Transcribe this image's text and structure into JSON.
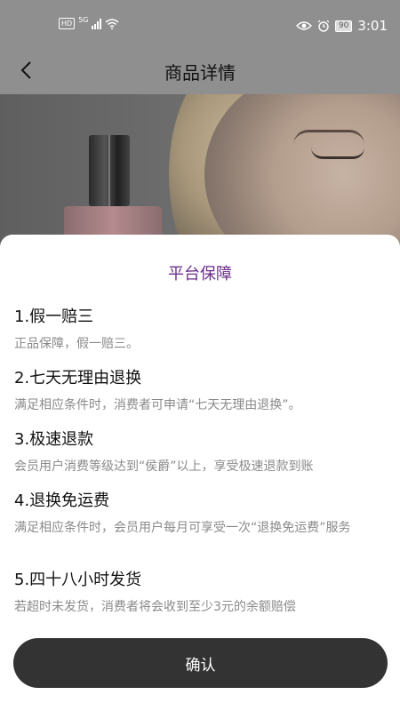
{
  "status_bar": {
    "hd": "HD",
    "network": "5G",
    "battery": "90",
    "time": "3:01"
  },
  "header": {
    "title": "商品详情"
  },
  "sheet": {
    "title": "平台保障",
    "items": [
      {
        "title": "1.假一赔三",
        "desc": "正品保障，假一赔三。"
      },
      {
        "title": "2.七天无理由退换",
        "desc": "满足相应条件时，消费者可申请“七天无理由退换”。"
      },
      {
        "title": "3.极速退款",
        "desc": "会员用户消费等级达到“侯爵”以上，享受极速退款到账"
      },
      {
        "title": "4.退换免运费",
        "desc": "满足相应条件时，会员用户每月可享受一次“退换免运费”服务"
      },
      {
        "title": "5.四十八小时发货",
        "desc": "若超时未发货，消费者将会收到至少3元的余额赔偿"
      }
    ],
    "confirm_label": "确认"
  },
  "colors": {
    "accent": "#6b2d8c",
    "button_bg": "#333333"
  }
}
